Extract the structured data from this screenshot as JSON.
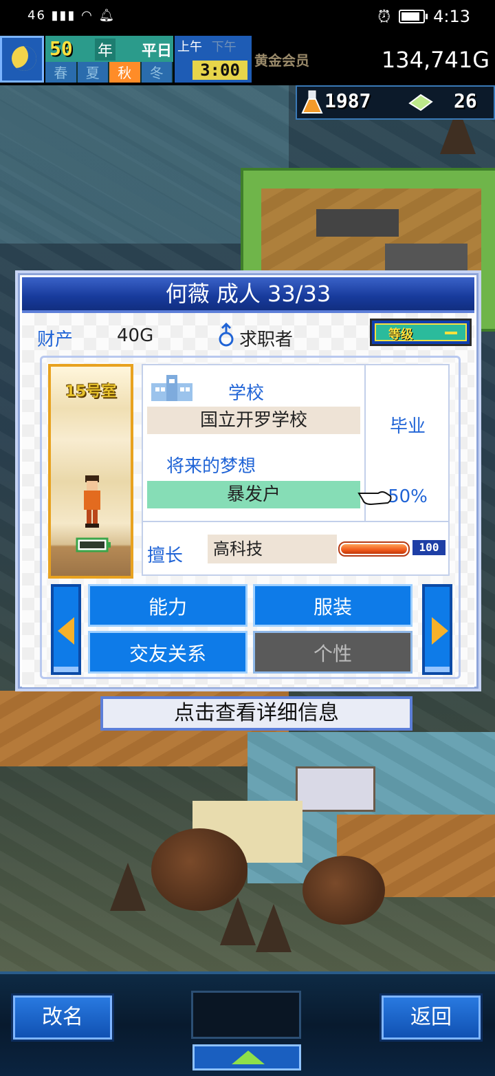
{
  "status_bar": {
    "network": "46",
    "time": "4:13"
  },
  "hud": {
    "year": "50",
    "year_unit": "年",
    "weekday": "平日",
    "seasons": [
      "春",
      "夏",
      "秋",
      "冬"
    ],
    "active_season_index": 2,
    "am": "上午",
    "pm": "下午",
    "clock": "3:00",
    "member": "黄金会员",
    "money": "134,741G",
    "research_points": "1987",
    "tickets": "26"
  },
  "dialog": {
    "title": "何薇 成人 33/33",
    "assets_label": "财产",
    "assets_value": "40G",
    "job_status": "求职者",
    "level_label": "等级",
    "room": "15号室",
    "school_label": "学校",
    "school_value": "国立开罗学校",
    "graduation": "毕业",
    "dream_label": "将来的梦想",
    "dream_value": "暴发户",
    "dream_progress": "50%",
    "skill_label": "擅长",
    "skill_value": "高科技",
    "skill_level": "100",
    "skill_fill": 1.0,
    "tabs": [
      "能力",
      "服装",
      "交友关系",
      "个性"
    ],
    "hint": "点击查看详细信息"
  },
  "bottom": {
    "rename": "改名",
    "back": "返回"
  }
}
